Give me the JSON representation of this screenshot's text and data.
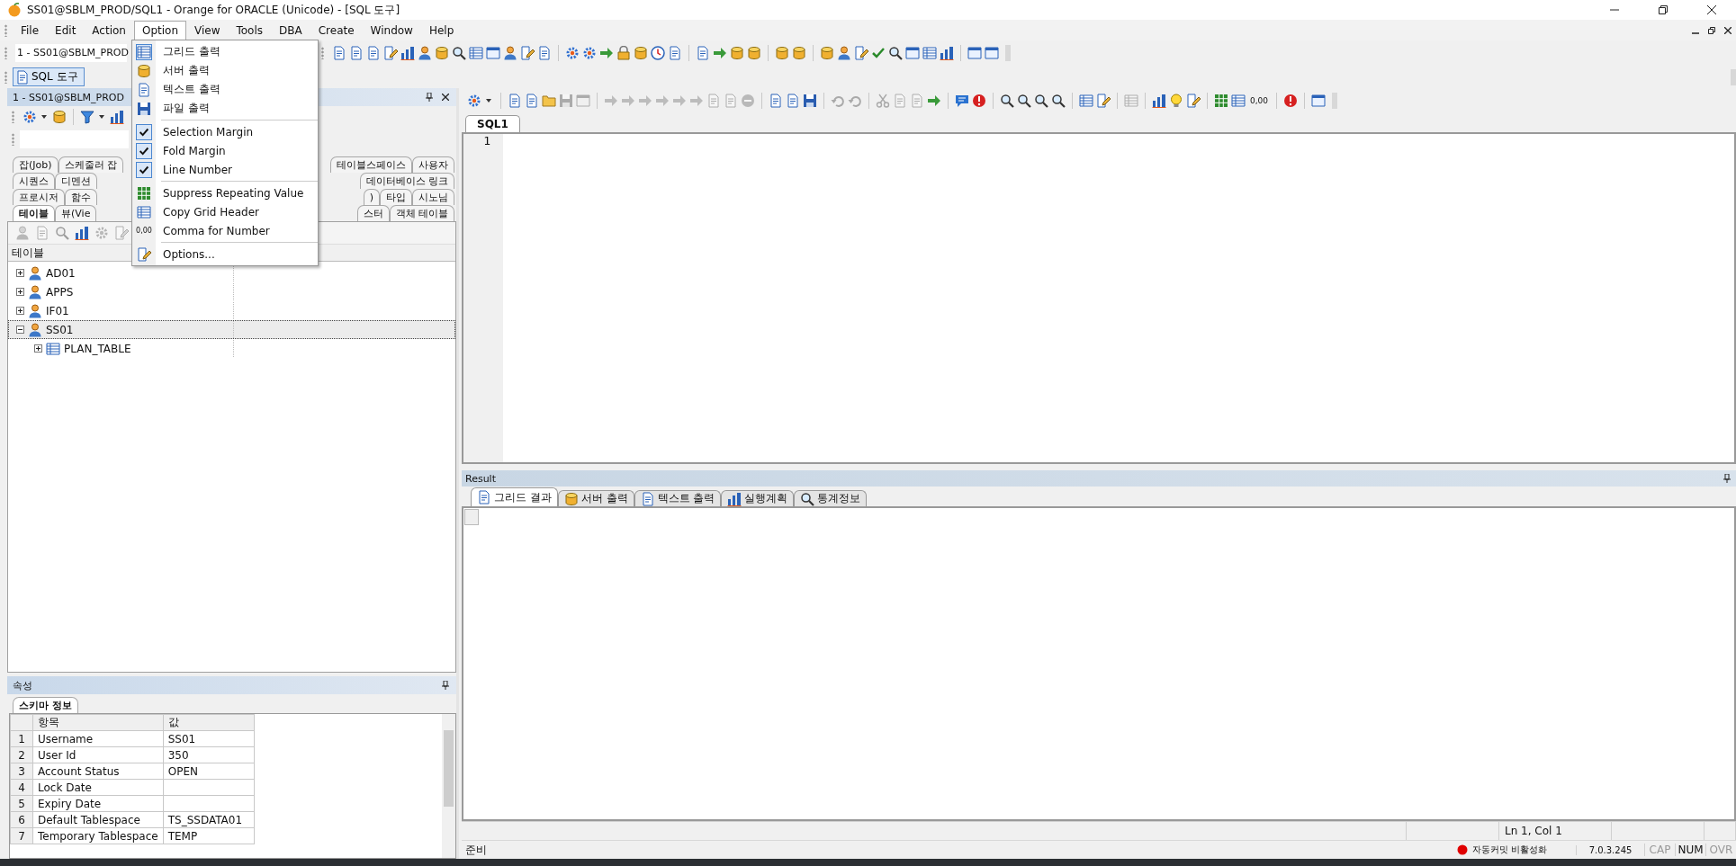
{
  "window": {
    "title": "SS01@SBLM_PROD/SQL1 - Orange for ORACLE (Unicode) - [SQL 도구]"
  },
  "menu_bar": [
    {
      "label": "File",
      "selected": false
    },
    {
      "label": "Edit",
      "selected": false
    },
    {
      "label": "Action",
      "selected": false
    },
    {
      "label": "Option",
      "selected": true
    },
    {
      "label": "View",
      "selected": false
    },
    {
      "label": "Tools",
      "selected": false
    },
    {
      "label": "DBA",
      "selected": false
    },
    {
      "label": "Create",
      "selected": false
    },
    {
      "label": "Window",
      "selected": false
    },
    {
      "label": "Help",
      "selected": false
    }
  ],
  "connection_combo": {
    "value": "1 - SS01@SBLM_PROD"
  },
  "sql_tool_button": {
    "label": "SQL 도구",
    "selected": true
  },
  "option_menu": [
    {
      "kind": "icon",
      "label": "그리드 출력",
      "checked": true
    },
    {
      "kind": "icon",
      "label": "서버 출력",
      "checked": false
    },
    {
      "kind": "icon",
      "label": "텍스트 출력",
      "checked": false
    },
    {
      "kind": "icon",
      "label": "파일 출력",
      "checked": false
    },
    {
      "kind": "separator"
    },
    {
      "kind": "check",
      "label": "Selection Margin",
      "checked": true
    },
    {
      "kind": "check",
      "label": "Fold Margin",
      "checked": true
    },
    {
      "kind": "check",
      "label": "Line Number",
      "checked": true
    },
    {
      "kind": "separator"
    },
    {
      "kind": "icon",
      "label": "Suppress Repeating Value",
      "checked": false
    },
    {
      "kind": "icon",
      "label": "Copy Grid Header",
      "checked": false
    },
    {
      "kind": "icon",
      "label": "Comma for Number",
      "checked": false,
      "icon_text": "0,00"
    },
    {
      "kind": "separator"
    },
    {
      "kind": "icon",
      "label": "Options...",
      "checked": false
    }
  ],
  "object_browser": {
    "title": "1 - SS01@SBLM_PROD",
    "tab_rows": [
      {
        "left": [
          {
            "label": "잡(Job)",
            "selected": false
          },
          {
            "label": "스케줄러 잡",
            "selected": false
          }
        ],
        "right": [
          {
            "label": "테이블스페이스",
            "selected": false
          },
          {
            "label": "사용자",
            "selected": false
          }
        ]
      },
      {
        "left": [
          {
            "label": "시퀀스",
            "selected": false
          },
          {
            "label": "디멘션",
            "selected": false
          }
        ],
        "right": [
          {
            "label": "데이터베이스 링크",
            "selected": false
          }
        ]
      },
      {
        "left": [
          {
            "label": "프로시저",
            "selected": false
          },
          {
            "label": "함수",
            "selected": false
          }
        ],
        "right": [
          {
            "label": ")",
            "selected": false
          },
          {
            "label": "타입",
            "selected": false
          },
          {
            "label": "시노님",
            "selected": false
          }
        ]
      },
      {
        "left": [
          {
            "label": "테이블",
            "selected": true
          },
          {
            "label": "뷰(Vie",
            "selected": false
          }
        ],
        "right": [
          {
            "label": "스터",
            "selected": false
          },
          {
            "label": "객체 테이블",
            "selected": false
          }
        ]
      }
    ],
    "object_toolbar": [
      {
        "disabled": true
      },
      {
        "disabled": true
      },
      {
        "disabled": true
      },
      {
        "disabled": false
      },
      {
        "disabled": true
      },
      {
        "disabled": true
      }
    ],
    "tree_header": "테이블",
    "tree": [
      {
        "kind": "schema",
        "label": "AD01",
        "expanded": false,
        "selected": false
      },
      {
        "kind": "schema",
        "label": "APPS",
        "expanded": false,
        "selected": false
      },
      {
        "kind": "schema",
        "label": "IF01",
        "expanded": false,
        "selected": false
      },
      {
        "kind": "schema",
        "label": "SS01",
        "expanded": true,
        "selected": true,
        "children": [
          {
            "kind": "table",
            "label": "PLAN_TABLE",
            "expanded": false,
            "selected": false
          }
        ]
      }
    ]
  },
  "properties": {
    "title": "속성",
    "tabs": [
      {
        "label": "스키마 정보",
        "selected": true
      }
    ],
    "columns": [
      "항목",
      "값"
    ],
    "rows": [
      {
        "number": "1",
        "item": "Username",
        "value": "SS01"
      },
      {
        "number": "2",
        "item": "User Id",
        "value": "350"
      },
      {
        "number": "3",
        "item": "Account Status",
        "value": "OPEN"
      },
      {
        "number": "4",
        "item": "Lock Date"
      },
      {
        "number": "5",
        "item": "Expiry Date"
      },
      {
        "number": "6",
        "item": "Default Tablespace",
        "value": "TS_SSDATA01"
      },
      {
        "number": "7",
        "item": "Temporary Tablespace",
        "value": "TEMP"
      }
    ]
  },
  "editor": {
    "toolbar": [
      {
        "disabled": false
      },
      {
        "disabled": false
      },
      {
        "disabled": false
      },
      {
        "disabled": false
      },
      {
        "disabled": true
      },
      {
        "disabled": true
      },
      {
        "disabled": true
      },
      {
        "disabled": true
      },
      {
        "disabled": true
      },
      {
        "disabled": true
      },
      {
        "disabled": true
      },
      {
        "disabled": true
      },
      {
        "disabled": true
      },
      {
        "disabled": true
      },
      {
        "disabled": true
      },
      {
        "disabled": false
      },
      {
        "disabled": false
      },
      {
        "disabled": false
      },
      {
        "disabled": true
      },
      {
        "disabled": true
      },
      {
        "disabled": true
      },
      {
        "disabled": true
      },
      {
        "disabled": true
      },
      {
        "disabled": false
      },
      {
        "disabled": false
      },
      {
        "disabled": false
      },
      {
        "disabled": false
      },
      {
        "disabled": false
      },
      {
        "disabled": false
      },
      {
        "disabled": false
      },
      {
        "disabled": false
      },
      {
        "disabled": false
      },
      {
        "disabled": true
      },
      {
        "disabled": false
      },
      {
        "disabled": false
      },
      {
        "disabled": false
      },
      {
        "disabled": false
      },
      {
        "disabled": false
      },
      {
        "disabled": false,
        "label": "0,00"
      },
      {
        "disabled": false
      },
      {
        "disabled": false
      }
    ],
    "tabs": [
      {
        "label": "SQL1",
        "selected": true
      }
    ],
    "line_numbers": [
      "1"
    ]
  },
  "result": {
    "title": "Result",
    "tabs": [
      {
        "label": "그리드 결과",
        "selected": true
      },
      {
        "label": "서버 출력",
        "selected": false
      },
      {
        "label": "텍스트 출력",
        "selected": false
      },
      {
        "label": "실행계획",
        "selected": false
      },
      {
        "label": "통계정보",
        "selected": false
      }
    ]
  },
  "status_bar": {
    "cursor": "Ln 1, Col 1",
    "message": "준비",
    "auto_commit": {
      "label": "자동커밋 비활성화",
      "on": false
    },
    "version": "7.0.3.245",
    "indicators": [
      {
        "label": "CAP",
        "on": false
      },
      {
        "label": "NUM",
        "on": true
      },
      {
        "label": "OVR",
        "on": false
      }
    ]
  }
}
